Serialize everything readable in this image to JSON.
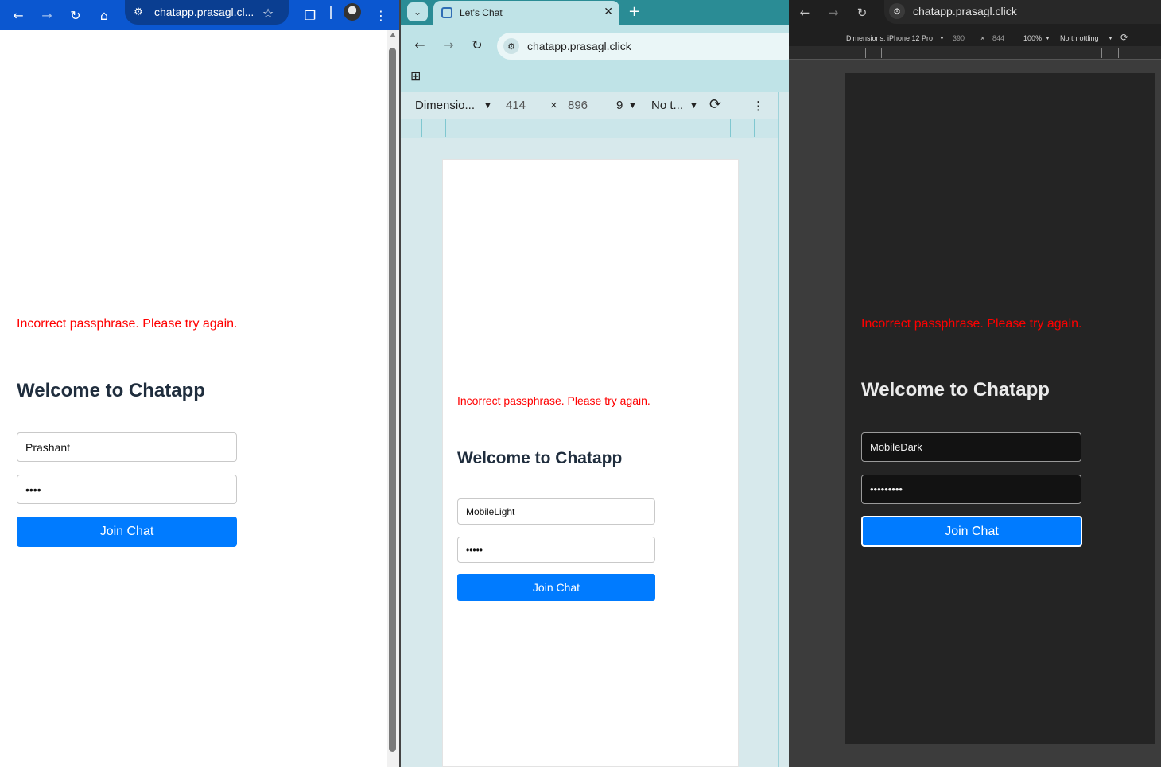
{
  "windows": {
    "left": {
      "theme": "desktop-light",
      "chrome_color": "#0b57d0",
      "address_bar": {
        "url": "chatapp.prasagl.cl..."
      },
      "icons": [
        "back-icon",
        "forward-icon",
        "reload-icon",
        "home-icon",
        "site-info-icon",
        "bookmark-star-icon",
        "extensions-icon",
        "profile-avatar",
        "menu-icon"
      ],
      "page": {
        "error": "Incorrect passphrase. Please try again.",
        "heading": "Welcome to Chatapp",
        "name_value": "Prashant",
        "passphrase_value": "••••",
        "button": "Join Chat"
      }
    },
    "middle": {
      "theme": "mobile-light",
      "chrome_color": "#2a8c95",
      "tab": {
        "title": "Let's Chat"
      },
      "address_bar": {
        "url": "chatapp.prasagl.click"
      },
      "devtools": {
        "device": "Dimensio...",
        "width": "414",
        "times": "×",
        "height": "896",
        "zoom": "9",
        "throttling": "No t..."
      },
      "page": {
        "error": "Incorrect passphrase. Please try again.",
        "heading": "Welcome to Chatapp",
        "name_value": "MobileLight",
        "passphrase_value": "•••••",
        "button": "Join Chat"
      }
    },
    "right": {
      "theme": "mobile-dark",
      "chrome_color": "#1f1f1f",
      "address_bar": {
        "url": "chatapp.prasagl.click"
      },
      "devtools": {
        "device": "Dimensions: iPhone 12 Pro",
        "width": "390",
        "times": "×",
        "height": "844",
        "zoom": "100%",
        "throttling": "No throttling"
      },
      "page": {
        "error": "Incorrect passphrase. Please try again.",
        "heading": "Welcome to Chatapp",
        "name_value": "MobileDark",
        "passphrase_value": "•••••••••",
        "button": "Join Chat"
      }
    }
  },
  "colors": {
    "error": "#ff0000",
    "button": "#007bff",
    "heading_light": "#1f2d3d",
    "heading_dark": "#ebebeb"
  }
}
